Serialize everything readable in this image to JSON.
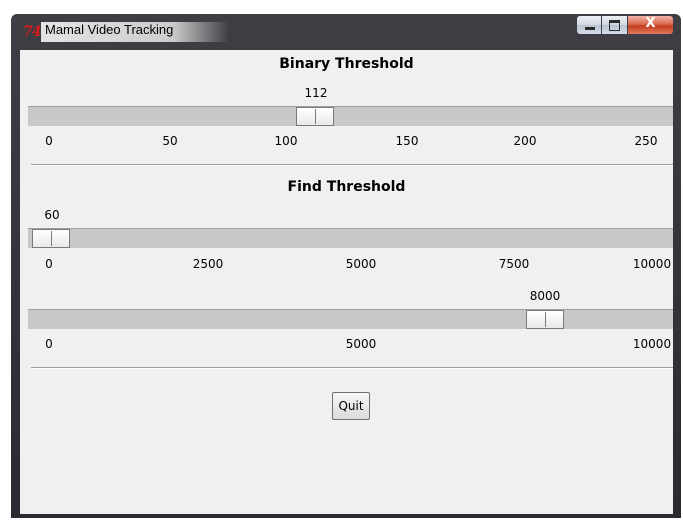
{
  "window": {
    "title": "Mamal Video Tracking",
    "app_icon_text": "74",
    "buttons": {
      "minimize": "minimize",
      "maximize": "maximize",
      "close": "X"
    }
  },
  "binary_threshold": {
    "title": "Binary Threshold",
    "value": "112",
    "ticks": [
      "0",
      "50",
      "100",
      "150",
      "200",
      "250"
    ]
  },
  "find_threshold": {
    "title": "Find Threshold",
    "value": "60",
    "ticks": [
      "0",
      "2500",
      "5000",
      "7500",
      "10000"
    ]
  },
  "third_scale": {
    "value": "8000",
    "ticks": [
      "0",
      "5000",
      "10000"
    ]
  },
  "quit_label": "Quit"
}
